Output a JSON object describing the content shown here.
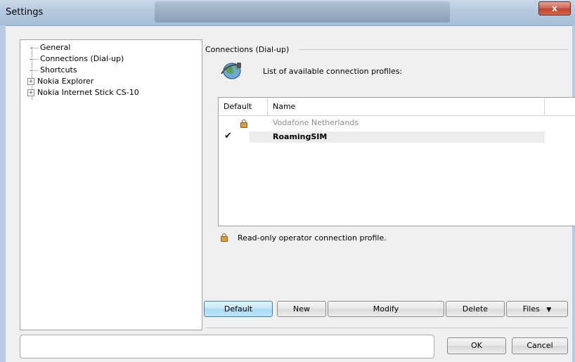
{
  "window": {
    "title": "Settings",
    "close_label": "x"
  },
  "tree": {
    "items": [
      {
        "label": "General",
        "expandable": false
      },
      {
        "label": "Connections (Dial-up)",
        "expandable": false
      },
      {
        "label": "Shortcuts",
        "expandable": false
      },
      {
        "label": "Nokia Explorer",
        "expandable": true
      },
      {
        "label": "Nokia Internet Stick CS-10",
        "expandable": true
      }
    ]
  },
  "group": {
    "title": "Connections (Dial-up)",
    "caption": "List of available connection profiles:"
  },
  "profiles": {
    "columns": [
      "Default",
      "Name"
    ],
    "rows": [
      {
        "name": "Vodafone Netherlands",
        "read_only": true,
        "default": false
      },
      {
        "name": "RoamingSIM",
        "read_only": false,
        "default": true
      }
    ]
  },
  "legend_note": "Read-only operator connection profile.",
  "buttons": {
    "default": "Default",
    "new": "New",
    "modify": "Modify",
    "delete": "Delete",
    "files": "Files",
    "ok": "OK",
    "cancel": "Cancel"
  },
  "colors": {
    "read_only_text": "#8c8c8c",
    "active_button": "#c4e5f6"
  }
}
